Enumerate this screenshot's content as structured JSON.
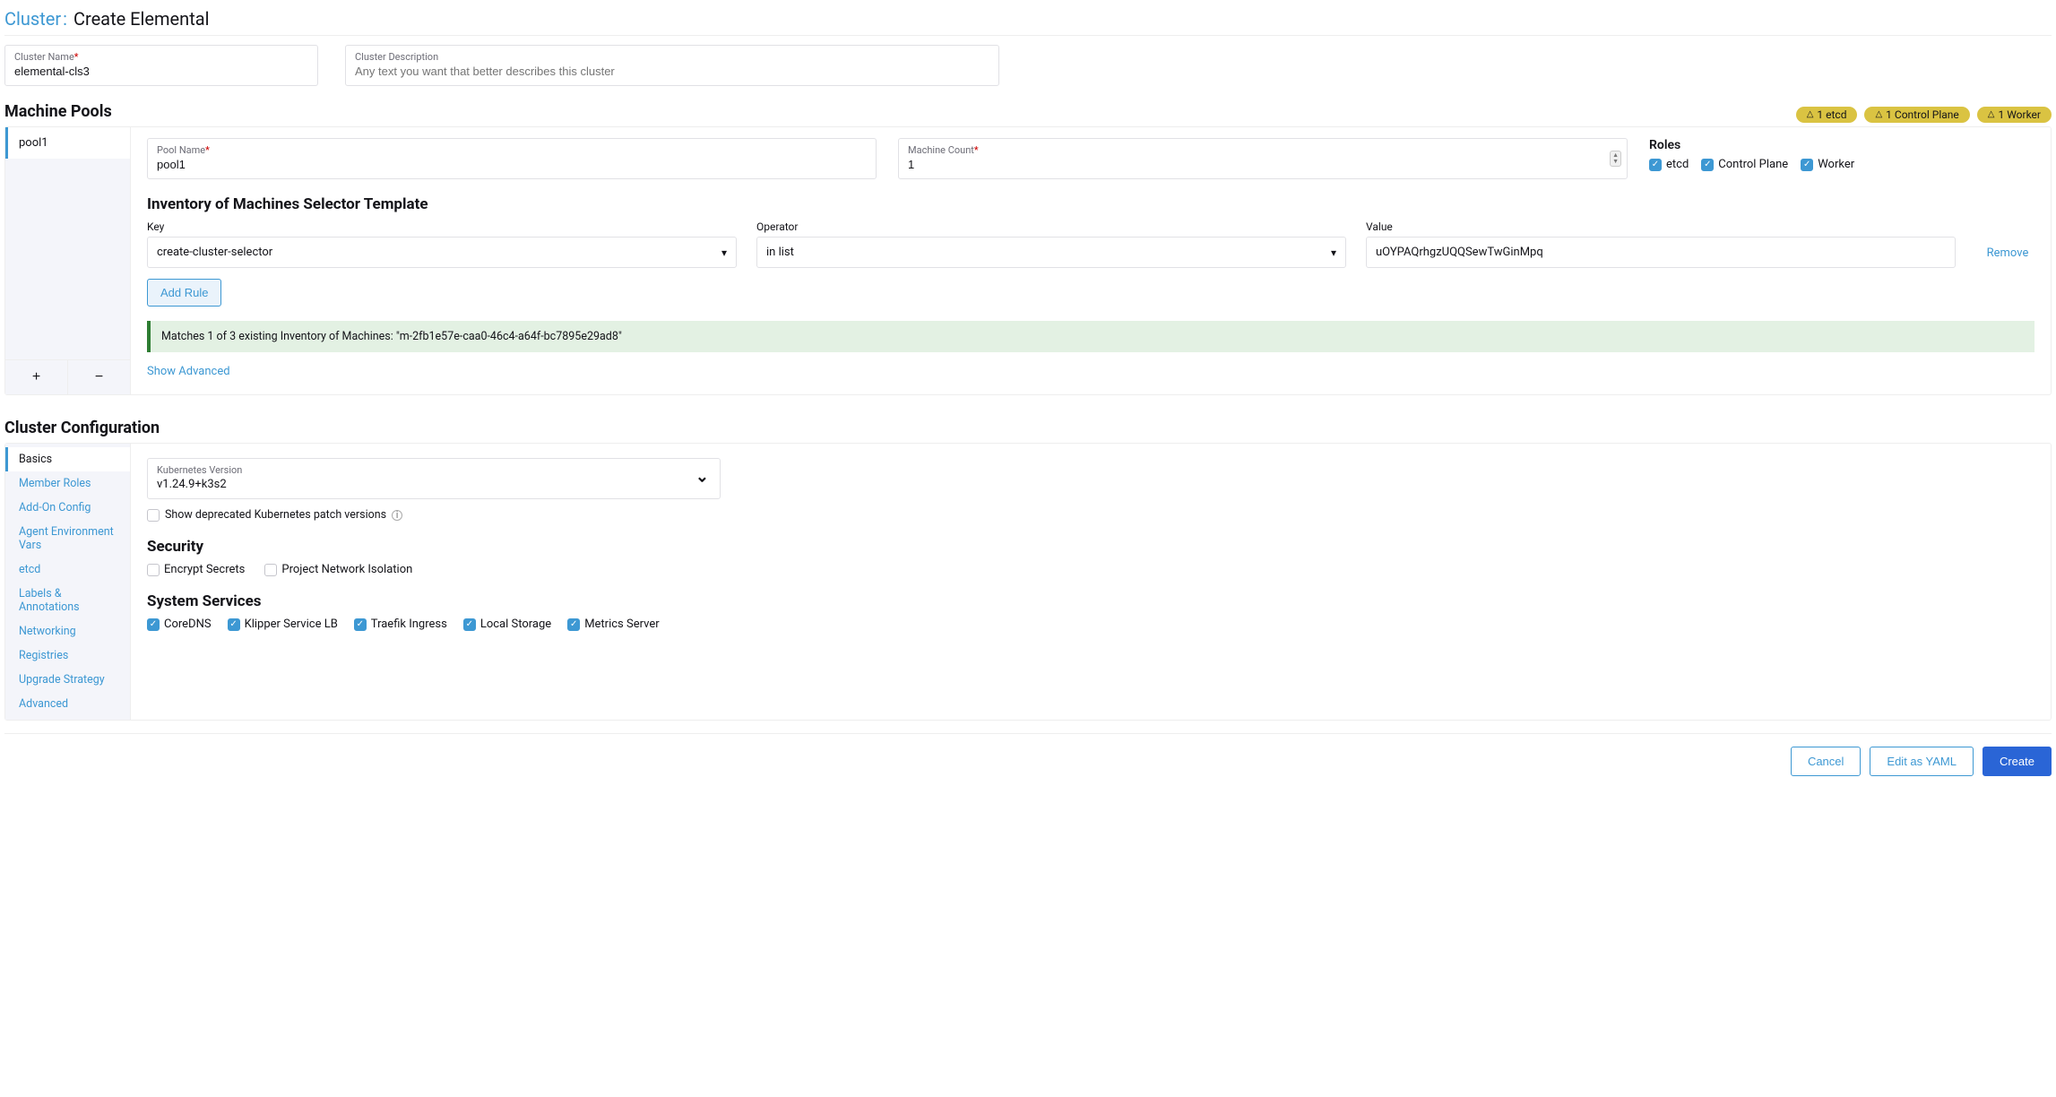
{
  "header": {
    "prefix": "Cluster",
    "sep": ":",
    "title": "Create Elemental"
  },
  "cluster_name": {
    "label": "Cluster Name",
    "value": "elemental-cls3"
  },
  "cluster_desc": {
    "label": "Cluster Description",
    "placeholder": "Any text you want that better describes this cluster"
  },
  "pools": {
    "title": "Machine Pools",
    "badges": [
      {
        "text": "1 etcd"
      },
      {
        "text": "1 Control Plane"
      },
      {
        "text": "1 Worker"
      }
    ],
    "tabs": [
      {
        "name": "pool1"
      }
    ],
    "pool_name": {
      "label": "Pool Name",
      "value": "pool1"
    },
    "machine_count": {
      "label": "Machine Count",
      "value": "1"
    },
    "roles": {
      "title": "Roles",
      "items": [
        {
          "label": "etcd",
          "checked": true
        },
        {
          "label": "Control Plane",
          "checked": true
        },
        {
          "label": "Worker",
          "checked": true
        }
      ]
    },
    "inventory_title": "Inventory of Machines Selector Template",
    "selector": {
      "key_label": "Key",
      "key_value": "create-cluster-selector",
      "op_label": "Operator",
      "op_value": "in list",
      "val_label": "Value",
      "val_value": "uOYPAQrhgzUQQSewTwGinMpq",
      "remove": "Remove"
    },
    "add_rule": "Add Rule",
    "match_msg": "Matches 1 of 3 existing Inventory of Machines: \"m-2fb1e57e-caa0-46c4-a64f-bc7895e29ad8\"",
    "show_advanced": "Show Advanced"
  },
  "config": {
    "title": "Cluster Configuration",
    "tabs": [
      "Basics",
      "Member Roles",
      "Add-On Config",
      "Agent Environment Vars",
      "etcd",
      "Labels & Annotations",
      "Networking",
      "Registries",
      "Upgrade Strategy",
      "Advanced"
    ],
    "k8s": {
      "label": "Kubernetes Version",
      "value": "v1.24.9+k3s2"
    },
    "deprecated": "Show deprecated Kubernetes patch versions",
    "security": {
      "title": "Security",
      "items": [
        {
          "label": "Encrypt Secrets",
          "checked": false
        },
        {
          "label": "Project Network Isolation",
          "checked": false
        }
      ]
    },
    "services": {
      "title": "System Services",
      "items": [
        {
          "label": "CoreDNS",
          "checked": true
        },
        {
          "label": "Klipper Service LB",
          "checked": true
        },
        {
          "label": "Traefik Ingress",
          "checked": true
        },
        {
          "label": "Local Storage",
          "checked": true
        },
        {
          "label": "Metrics Server",
          "checked": true
        }
      ]
    }
  },
  "footer": {
    "cancel": "Cancel",
    "yaml": "Edit as YAML",
    "create": "Create"
  }
}
